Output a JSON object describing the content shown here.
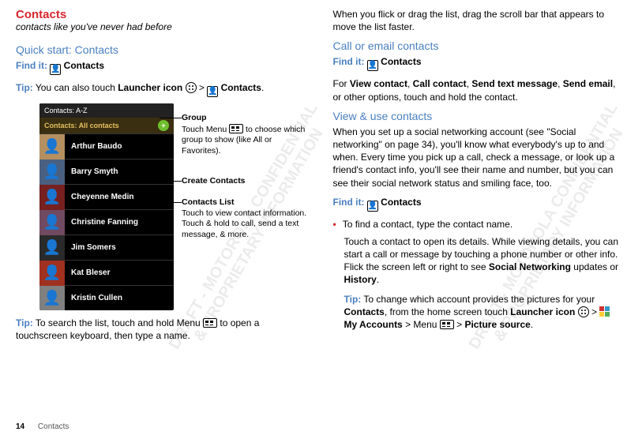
{
  "left": {
    "title": "Contacts",
    "subtitle": "contacts like you've never had before",
    "quick_start_heading": "Quick start: Contacts",
    "find_it_label": "Find it:",
    "contacts_bold": "Contacts",
    "tip_label": "Tip:",
    "tip1_a": " You can also touch ",
    "tip1_b": "Launcher icon",
    "tip1_c": " > ",
    "tip1_d": "Contacts",
    "tip1_e": ".",
    "phone": {
      "bar_top": "Contacts: A-Z",
      "bar_gold": "Contacts: All contacts",
      "rows": [
        "Arthur Baudo",
        "Barry Smyth",
        "Cheyenne Medin",
        "Christine Fanning",
        "Jim Somers",
        "Kat Bleser",
        "Kristin Cullen"
      ]
    },
    "annot": {
      "group_t": "Group",
      "group_b_a": "Touch Menu ",
      "group_b_b": " to choose which group to show (like All or Favorites).",
      "create_t": "Create Contacts",
      "list_t": "Contacts  List",
      "list_b": "Touch to view contact information. Touch & hold to call, send a text message, & more."
    },
    "tip2_a": " To search the list, touch and hold Menu ",
    "tip2_b": " to open a touchscreen keyboard, then type a name."
  },
  "right": {
    "intro": "When you flick or drag the list, drag the scroll bar that appears to move the list faster.",
    "h_call": "Call or email contacts",
    "find_it_label": "Find it:",
    "contacts_bold": "Contacts",
    "call_para_a": "For ",
    "call_para_b": "View contact",
    "call_para_c": ", ",
    "call_para_d": "Call contact",
    "call_para_e": ", ",
    "call_para_f": "Send text message",
    "call_para_g": ", ",
    "call_para_h": "Send email",
    "call_para_i": ", or other options, touch and hold the contact.",
    "h_view": "View & use contacts",
    "view_para": "When you set up a social networking account (see \"Social networking\" on page 34), you'll know what everybody's up to and when. Every time you pick up a call, check a message, or look up a friend's contact info, you'll see their name and number, but you can see their social network status and smiling face, too.",
    "bullet1": "To find a contact, type the contact name.",
    "bullet2_a": "Touch a contact to open its details. While viewing details, you can start a call or message by touching a phone number or other info. Flick the screen left or right to see ",
    "bullet2_b": "Social Networking",
    "bullet2_c": " updates or ",
    "bullet2_d": "History",
    "bullet2_e": ".",
    "tip_label": "Tip:",
    "tip3_a": " To change which account provides the pictures for your ",
    "tip3_b": "Contacts",
    "tip3_c": ", from the home screen touch ",
    "tip3_d": "Launcher icon",
    "tip3_e": " > ",
    "tip3_f": "My Accounts",
    "tip3_g": " > Menu ",
    "tip3_h": " > ",
    "tip3_i": "Picture source",
    "tip3_j": "."
  },
  "footer": {
    "page": "14",
    "section": "Contacts"
  },
  "avatar_colors": [
    "#b49060",
    "#4a6080",
    "#762020",
    "#704a60",
    "#2a2a2a",
    "#a03020",
    "#808080"
  ]
}
